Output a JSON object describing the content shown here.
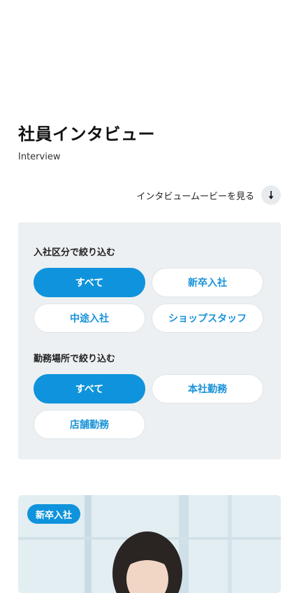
{
  "header": {
    "title": "社員インタビュー",
    "subtitle": "Interview"
  },
  "movie_link": {
    "label": "インタビュームービーを見る",
    "icon": "arrow-down-icon"
  },
  "filters": {
    "group1": {
      "heading": "入社区分で絞り込む",
      "options": [
        {
          "label": "すべて",
          "selected": true
        },
        {
          "label": "新卒入社",
          "selected": false
        },
        {
          "label": "中途入社",
          "selected": false
        },
        {
          "label": "ショップスタッフ",
          "selected": false
        }
      ]
    },
    "group2": {
      "heading": "勤務場所で絞り込む",
      "options": [
        {
          "label": "すべて",
          "selected": true
        },
        {
          "label": "本社勤務",
          "selected": false
        },
        {
          "label": "店舗勤務",
          "selected": false
        }
      ]
    }
  },
  "cards": [
    {
      "badge": "新卒入社"
    }
  ],
  "colors": {
    "accent": "#0f93dc",
    "panel_bg": "#ecf0f2"
  }
}
